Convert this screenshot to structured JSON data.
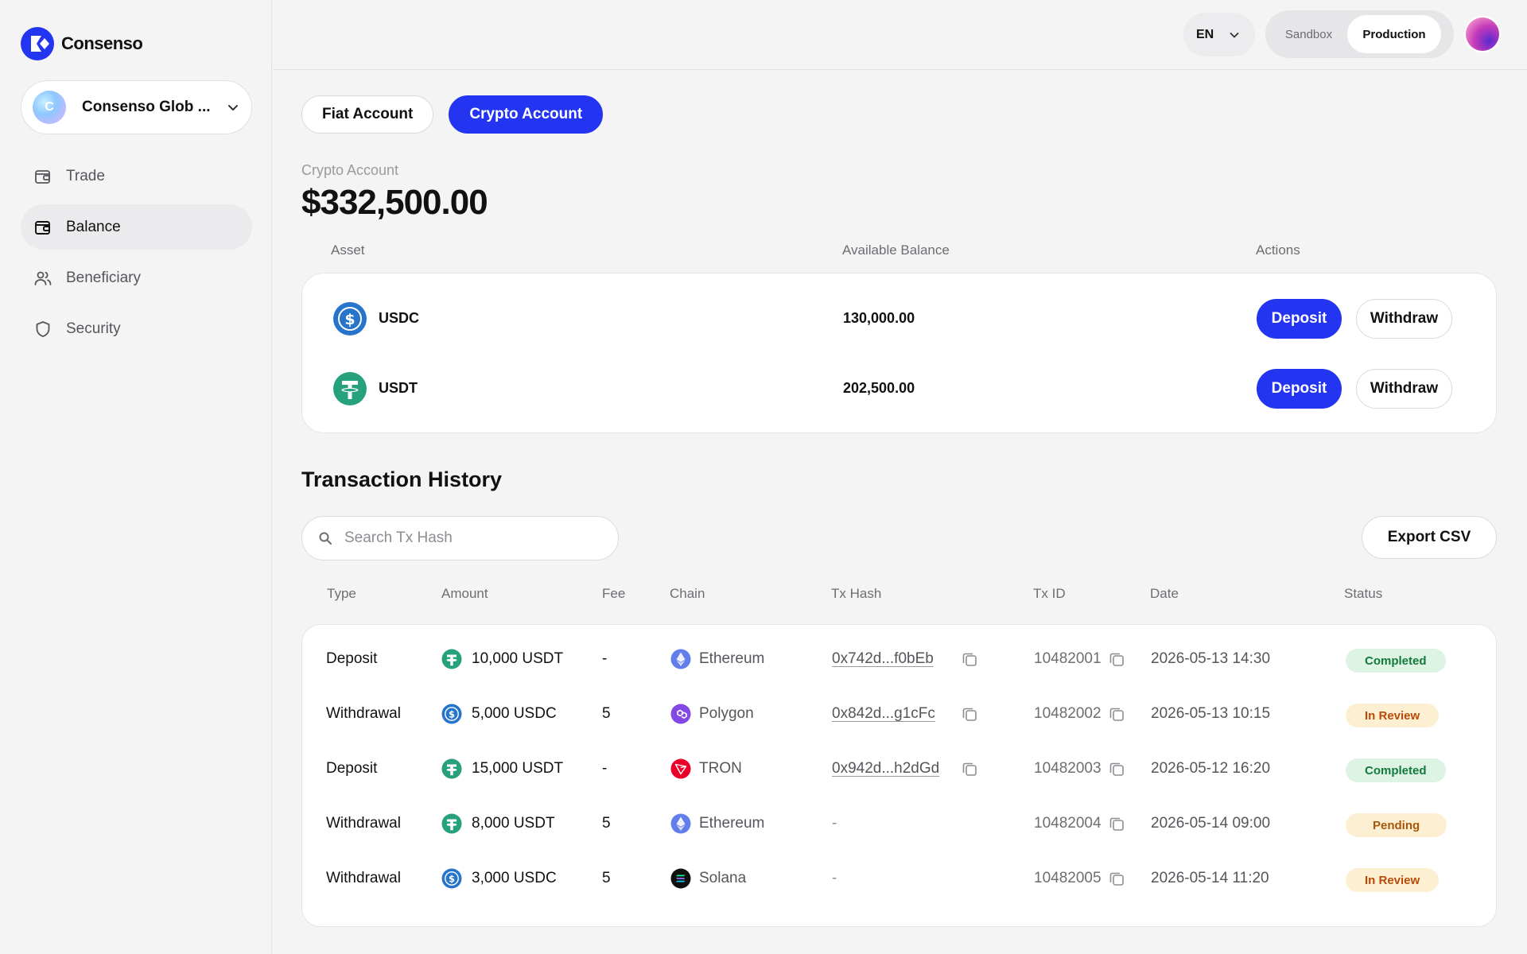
{
  "brand": {
    "name": "Consenso"
  },
  "org": {
    "name": "Consenso Glob ...",
    "initial": "C"
  },
  "nav": {
    "items": [
      {
        "label": "Trade",
        "icon": "wallet-icon",
        "active": false
      },
      {
        "label": "Balance",
        "icon": "wallet-icon",
        "active": true
      },
      {
        "label": "Beneficiary",
        "icon": "users-icon",
        "active": false
      },
      {
        "label": "Security",
        "icon": "shield-icon",
        "active": false
      }
    ]
  },
  "topbar": {
    "language": "EN",
    "environments": [
      "Sandbox",
      "Production"
    ],
    "active_environment": "Production"
  },
  "account_tabs": [
    {
      "label": "Fiat Account",
      "active": false
    },
    {
      "label": "Crypto Account",
      "active": true
    }
  ],
  "account": {
    "label": "Crypto Account",
    "total": "$332,500.00"
  },
  "assets": {
    "headers": {
      "asset": "Asset",
      "balance": "Available Balance",
      "actions": "Actions"
    },
    "rows": [
      {
        "symbol": "USDC",
        "icon": "usdc-icon",
        "balance": "130,000.00",
        "deposit_label": "Deposit",
        "withdraw_label": "Withdraw"
      },
      {
        "symbol": "USDT",
        "icon": "usdt-icon",
        "balance": "202,500.00",
        "deposit_label": "Deposit",
        "withdraw_label": "Withdraw"
      }
    ]
  },
  "transactions": {
    "title": "Transaction History",
    "search_placeholder": "Search Tx Hash",
    "export_label": "Export CSV",
    "headers": {
      "type": "Type",
      "amount": "Amount",
      "fee": "Fee",
      "chain": "Chain",
      "tx_hash": "Tx Hash",
      "tx_id": "Tx ID",
      "date": "Date",
      "status": "Status"
    },
    "rows": [
      {
        "type": "Deposit",
        "amount": "10,000 USDT",
        "asset": "usdt",
        "fee": "-",
        "chain": "Ethereum",
        "chain_icon": "ethereum-icon",
        "tx_hash": "0x742d...f0bEb",
        "tx_id": "10482001",
        "date": "2026-05-13 14:30",
        "status": "Completed"
      },
      {
        "type": "Withdrawal",
        "amount": "5,000 USDC",
        "asset": "usdc",
        "fee": "5",
        "chain": "Polygon",
        "chain_icon": "polygon-icon",
        "tx_hash": "0x842d...g1cFc",
        "tx_id": "10482002",
        "date": "2026-05-13 10:15",
        "status": "In Review"
      },
      {
        "type": "Deposit",
        "amount": "15,000 USDT",
        "asset": "usdt",
        "fee": "-",
        "chain": "TRON",
        "chain_icon": "tron-icon",
        "tx_hash": "0x942d...h2dGd",
        "tx_id": "10482003",
        "date": "2026-05-12 16:20",
        "status": "Completed"
      },
      {
        "type": "Withdrawal",
        "amount": "8,000 USDT",
        "asset": "usdt",
        "fee": "5",
        "chain": "Ethereum",
        "chain_icon": "ethereum-icon",
        "tx_hash": "-",
        "tx_id": "10482004",
        "date": "2026-05-14 09:00",
        "status": "Pending"
      },
      {
        "type": "Withdrawal",
        "amount": "3,000 USDC",
        "asset": "usdc",
        "fee": "5",
        "chain": "Solana",
        "chain_icon": "solana-icon",
        "tx_hash": "-",
        "tx_id": "10482005",
        "date": "2026-05-14 11:20",
        "status": "In Review"
      }
    ]
  },
  "colors": {
    "accent": "#2335F0",
    "usdc": "#2775CA",
    "usdt": "#26A17B",
    "status_completed_bg": "#DDF3E4",
    "status_review_bg": "#FDF0D2"
  }
}
